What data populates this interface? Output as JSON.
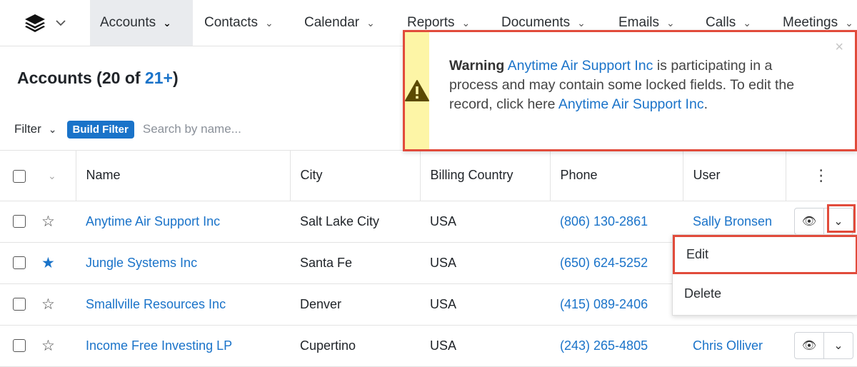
{
  "nav": {
    "logo_icon": "layers-icon",
    "tabs": [
      {
        "label": "Accounts",
        "active": true
      },
      {
        "label": "Contacts"
      },
      {
        "label": "Calendar"
      },
      {
        "label": "Reports"
      },
      {
        "label": "Documents"
      },
      {
        "label": "Emails"
      },
      {
        "label": "Calls"
      },
      {
        "label": "Meetings"
      }
    ]
  },
  "header": {
    "title_prefix": "Accounts (20 of ",
    "count_link": "21+",
    "title_suffix": ")"
  },
  "filter": {
    "label": "Filter",
    "build_label": "Build Filter",
    "search_placeholder": "Search by name..."
  },
  "table": {
    "columns": [
      "Name",
      "City",
      "Billing Country",
      "Phone",
      "User"
    ],
    "rows": [
      {
        "name": "Anytime Air Support Inc",
        "city": "Salt Lake City",
        "country": "USA",
        "phone": "(806) 130-2861",
        "user": "Sally Bronsen",
        "favorite": false
      },
      {
        "name": "Jungle Systems Inc",
        "city": "Santa Fe",
        "country": "USA",
        "phone": "(650) 624-5252",
        "user": "",
        "favorite": true
      },
      {
        "name": "Smallville Resources Inc",
        "city": "Denver",
        "country": "USA",
        "phone": "(415) 089-2406",
        "user": "",
        "favorite": false
      },
      {
        "name": "Income Free Investing LP",
        "city": "Cupertino",
        "country": "USA",
        "phone": "(243) 265-4805",
        "user": "Chris Olliver",
        "favorite": false
      }
    ]
  },
  "alert": {
    "strong": "Warning",
    "record_link": "Anytime Air Support Inc",
    "message": "is participating in a process and may contain some locked fields. To edit the record, click here",
    "edit_link": "Anytime Air Support Inc",
    "end": ".",
    "close": "×",
    "accent": "#fdf5a6"
  },
  "row_menu": {
    "items": [
      "Edit",
      "Delete"
    ]
  },
  "colors": {
    "link": "#1a73c9",
    "highlight": "#e14b3b"
  }
}
